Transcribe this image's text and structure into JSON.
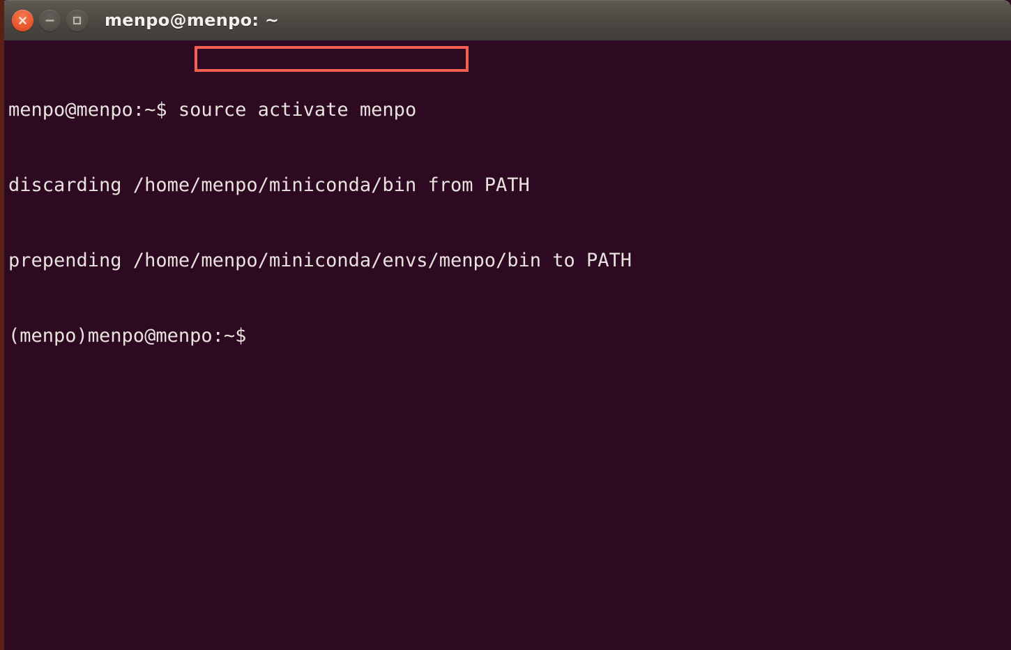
{
  "window": {
    "title": "menpo@menpo: ~",
    "controls": [
      {
        "name": "close",
        "label": "Close",
        "glyph": "x",
        "color": "#e9552c"
      },
      {
        "name": "minimize",
        "label": "Minimize",
        "glyph": "minus",
        "color": "#535049"
      },
      {
        "name": "maximize",
        "label": "Maximize",
        "glyph": "square",
        "color": "#535049"
      }
    ]
  },
  "terminal": {
    "background_color": "#2d0922",
    "text_color": "#e8e3dd",
    "lines": [
      "menpo@menpo:~$ source activate menpo",
      "discarding /home/menpo/miniconda/bin from PATH",
      "prepending /home/menpo/miniconda/envs/menpo/bin to PATH",
      "(menpo)menpo@menpo:~$"
    ],
    "prompt": "(menpo)menpo@menpo:~$",
    "command": "source activate menpo"
  },
  "annotation": {
    "box_color": "#f4604f",
    "target_text": "source activate menpo"
  }
}
